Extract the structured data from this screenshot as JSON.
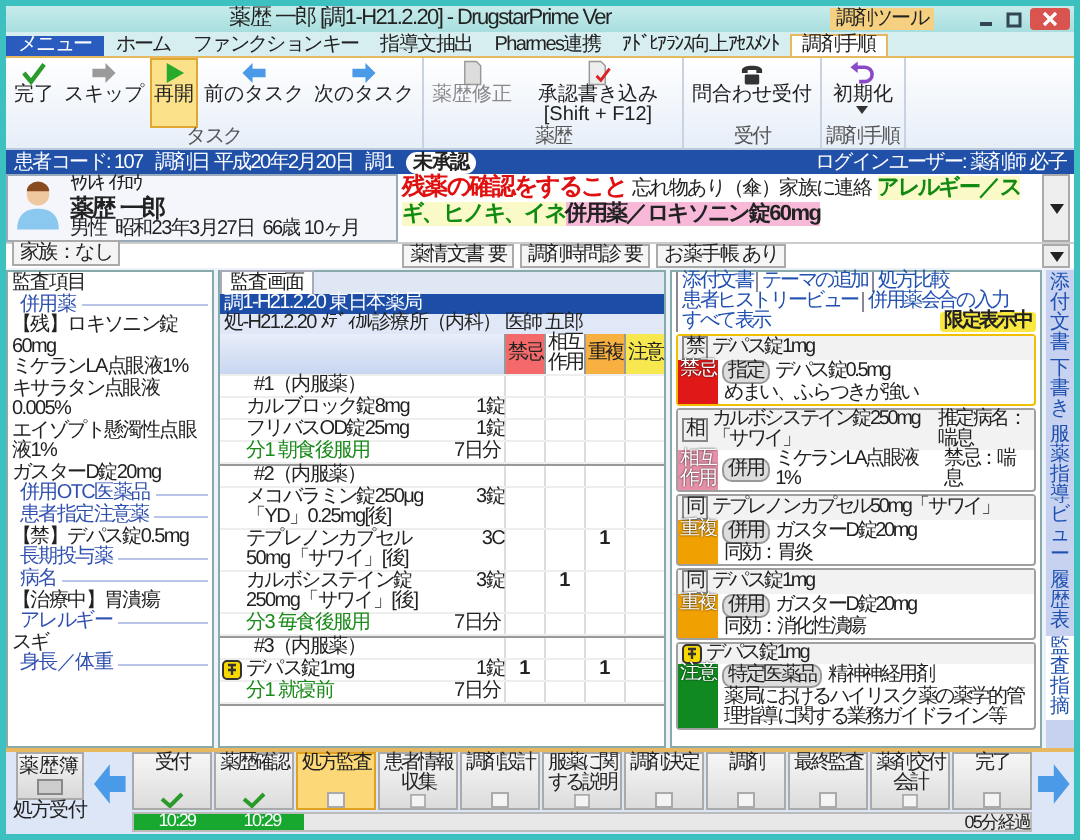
{
  "window": {
    "title": "薬歴 一郎 [調1-H21.2.20] - DrugstarPrime Ver",
    "context_tab": "調剤ツール"
  },
  "menu_button": "メニュー",
  "ribbon_tabs": [
    {
      "label": "ホーム",
      "selected": false
    },
    {
      "label": "ファンクションキー",
      "selected": false
    },
    {
      "label": "指導文抽出",
      "selected": false
    },
    {
      "label": "Pharmes連携",
      "selected": false
    },
    {
      "label": "ｱﾄﾞﾋｱﾗﾝｽ向上ｱｾｽﾒﾝﾄ",
      "selected": false
    },
    {
      "label": "調剤手順",
      "selected": true
    }
  ],
  "ribbon_groups": [
    {
      "label": "タスク",
      "buttons": [
        {
          "label": "完了",
          "selected": false,
          "disabled": false
        },
        {
          "label": "スキップ",
          "selected": false,
          "disabled": false
        },
        {
          "label": "再開",
          "selected": true,
          "disabled": false
        },
        {
          "label": "前のタスク",
          "selected": false,
          "disabled": false
        },
        {
          "label": "次のタスク",
          "selected": false,
          "disabled": false
        }
      ]
    },
    {
      "label": "薬歴",
      "buttons": [
        {
          "label": "薬歴修正",
          "selected": false,
          "disabled": true
        },
        {
          "label": "承認書き込み [Shift + F12]",
          "selected": false,
          "disabled": false
        }
      ]
    },
    {
      "label": "受付",
      "buttons": [
        {
          "label": "問合わせ受付",
          "selected": false,
          "disabled": false
        }
      ]
    },
    {
      "label": "調剤手順",
      "buttons": [
        {
          "label": "初期化",
          "selected": false,
          "disabled": false
        }
      ]
    }
  ],
  "info_bar": {
    "patient_code": "患者コード: 107",
    "dispense_date": "調剤日 平成20年2月20日",
    "dispense_no": "調1",
    "approval": "未承認",
    "login_user": "ログインユーザー: 薬剤師 必子"
  },
  "patient": {
    "kana": "ﾔｸﾚｷ ｲﾁﾛｳ",
    "name": "薬歴 一郎",
    "sex": "男性",
    "birthdate": "昭和23年3月27日",
    "age": "66歳 10ヶ月",
    "family": "家族：なし"
  },
  "alert": [
    {
      "kind": "warning",
      "text": "残薬の確認をすること"
    },
    {
      "kind": "plain",
      "text": "忘れ物あり（傘）家族に連絡"
    },
    {
      "kind": "allergy",
      "text": "アレルギー／スギ、ヒノキ、イネ"
    },
    {
      "kind": "concomitant",
      "text": "併用薬／ロキソニン錠60mg"
    }
  ],
  "tags": [
    {
      "label": "薬情文書",
      "value": "要"
    },
    {
      "label": "調剤時問診",
      "value": "要"
    },
    {
      "label": "お薬手帳",
      "value": "あり"
    }
  ],
  "audit_items": {
    "title": "監査項目",
    "sections": [
      {
        "heading": "併用薬",
        "items": [
          "【残】ロキソニン錠60mg",
          "ミケランLA点眼液1%",
          "キサラタン点眼液0.005%",
          "エイゾプト懸濁性点眼液1%",
          "ガスターD錠20mg"
        ]
      },
      {
        "heading": "併用OTC医薬品"
      },
      {
        "heading": "患者指定注意薬",
        "items": [
          "【禁】デパス錠0.5mg"
        ]
      },
      {
        "heading": "長期投与薬"
      },
      {
        "heading": "病名",
        "items": [
          "【治療中】胃潰瘍"
        ]
      },
      {
        "heading": "アレルギー",
        "items": [
          "スギ"
        ]
      },
      {
        "heading": "身長／体重"
      }
    ]
  },
  "prescription": {
    "tab": {
      "label": "監査画面",
      "selected": true
    },
    "pharmacy": "調1-H21.2.20 東日本薬局",
    "source": "処-H21.2.20 ﾒﾃﾞｨｶﾙ診療所（内科） 医師 五郎",
    "check_columns": [
      {
        "kind": "contraindication",
        "label": "禁忌",
        "color": "#f46a6a"
      },
      {
        "kind": "interaction",
        "label": "相互作用",
        "color": "#ffffff"
      },
      {
        "kind": "duplication",
        "label": "重複",
        "color": "#f8b040"
      },
      {
        "kind": "caution",
        "label": "注意",
        "color": "#f8e850"
      }
    ],
    "groups": [
      {
        "title": "#1（内服薬）",
        "usage": "分1 朝食後服用",
        "days": "7日分",
        "drugs": [
          {
            "name": "カルブロック錠8mg",
            "qty": "1錠",
            "high_risk": false
          },
          {
            "name": "フリバスOD錠25mg",
            "qty": "1錠",
            "high_risk": false
          }
        ]
      },
      {
        "title": "#2（内服薬）",
        "usage": "分3 毎食後服用",
        "days": "7日分",
        "drugs": [
          {
            "name": "メコバラミン錠250μg「YD」0.25mg[後]",
            "qty": "3錠",
            "high_risk": false
          },
          {
            "name": "テプレノンカプセル50mg「サワイ」[後]",
            "qty": "3C",
            "high_risk": false,
            "duplication": "1"
          },
          {
            "name": "カルボシステイン錠250mg「サワイ」[後]",
            "qty": "3錠",
            "high_risk": false,
            "interaction": "1"
          }
        ]
      },
      {
        "title": "#3（内服薬）",
        "usage": "分1 就寝前",
        "days": "7日分",
        "drugs": [
          {
            "name": "デパス錠1mg",
            "qty": "1錠",
            "high_risk": true,
            "contraindication": "1",
            "duplication": "1"
          }
        ]
      }
    ]
  },
  "findings": {
    "links": [
      "添付文書",
      "テーマの追加",
      "処方比較",
      "患者ヒストリービュー",
      "併用薬会合の入力",
      "すべて表示"
    ],
    "filter_badge": "限定表示中",
    "cards": [
      {
        "high_risk": false,
        "badge": "禁",
        "drug": "デパス錠1mg",
        "category": "禁忌",
        "color": "#e01818",
        "tag": "指定",
        "target": "デパス錠0.5mg",
        "detail": "めまい、ふらつきが強い",
        "selected": true
      },
      {
        "high_risk": false,
        "badge": "相",
        "drug": "カルボシステイン錠250mg「サワイ」",
        "note": "推定病名：喘息",
        "category": "相互作用",
        "color": "#e890a8",
        "tag": "併用",
        "target": "ミケランLA点眼液1%",
        "target_note": "禁忌：喘息",
        "selected": false
      },
      {
        "high_risk": false,
        "badge": "同",
        "drug": "テプレノンカプセル50mg「サワイ」",
        "category": "重複",
        "color": "#f0a000",
        "tag": "併用",
        "target": "ガスターD錠20mg",
        "detail": "同効：胃炎",
        "selected": false
      },
      {
        "high_risk": false,
        "badge": "同",
        "drug": "デパス錠1mg",
        "category": "重複",
        "color": "#f0a000",
        "tag": "併用",
        "target": "ガスターD錠20mg",
        "detail": "同効：消化性潰瘍",
        "selected": false
      },
      {
        "high_risk": true,
        "drug": "デパス錠1mg",
        "category": "注意",
        "color": "#108a20",
        "tag": "特定医薬品",
        "target": "精神神経用剤",
        "detail": "薬局におけるハイリスク薬の薬学的管理指導に関する業務ガイドライン等",
        "selected": false
      }
    ]
  },
  "side_tabs": [
    {
      "label": "添付文書",
      "selected": false
    },
    {
      "label": "下書き",
      "selected": false
    },
    {
      "label": "服薬指導ビュー",
      "selected": false
    },
    {
      "label": "履歴表",
      "selected": false
    },
    {
      "label": "監査指摘",
      "selected": true
    }
  ],
  "workflow": {
    "history_button": "薬歴簿",
    "history_caption": "処方受付",
    "steps": [
      {
        "label": "受付",
        "done": true,
        "selected": false
      },
      {
        "label": "薬歴確認",
        "done": true,
        "selected": false
      },
      {
        "label": "処方監査",
        "done": false,
        "selected": true
      },
      {
        "label": "患者情報収集",
        "done": false,
        "selected": false
      },
      {
        "label": "調剤設計",
        "done": false,
        "selected": false
      },
      {
        "label": "服薬に関する説明",
        "done": false,
        "selected": false
      },
      {
        "label": "調剤決定",
        "done": false,
        "selected": false
      },
      {
        "label": "調剤",
        "done": false,
        "selected": false
      },
      {
        "label": "最終監査",
        "done": false,
        "selected": false
      },
      {
        "label": "薬剤交付会計",
        "done": false,
        "selected": false
      },
      {
        "label": "完了",
        "done": false,
        "selected": false
      }
    ],
    "progress": {
      "level": 0.19,
      "times": [
        "10:29",
        "10:29"
      ],
      "elapsed": "05分経過"
    }
  }
}
